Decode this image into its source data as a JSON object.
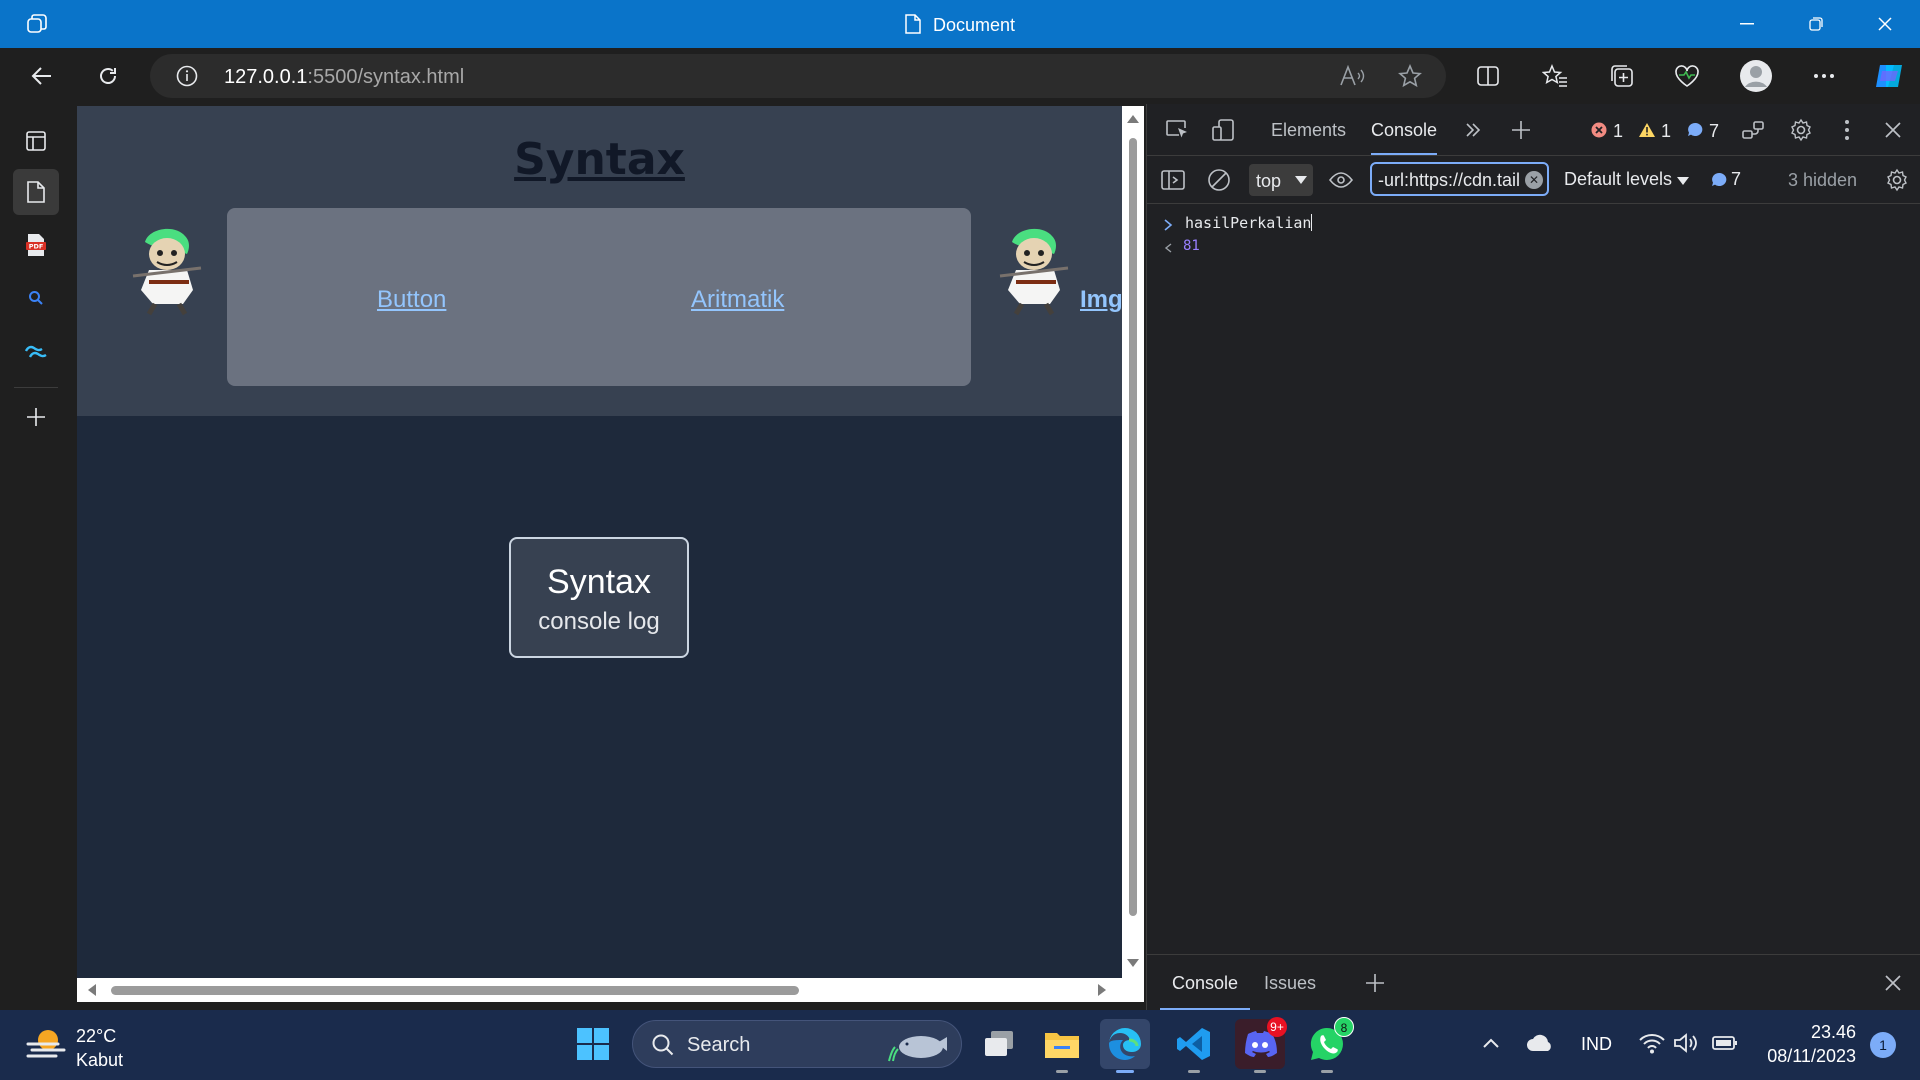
{
  "window": {
    "title": "Document"
  },
  "addressbar": {
    "url_host": "127.0.0.1",
    "url_rest": ":5500/syntax.html"
  },
  "page": {
    "title": "Syntax",
    "nav": [
      "Button",
      "Aritmatik"
    ],
    "img_link": "Img",
    "card": {
      "title": "Syntax",
      "subtitle": "console log"
    }
  },
  "devtools": {
    "tabs": [
      "Elements",
      "Console"
    ],
    "errors": "1",
    "warnings": "1",
    "messages": "7",
    "context": "top",
    "filter": "-url:https://cdn.tail",
    "levels": "Default levels",
    "level_count": "7",
    "hidden": "3 hidden",
    "input_line": "hasilPerkalian",
    "output_line": "81",
    "drawer_tabs": [
      "Console",
      "Issues"
    ]
  },
  "taskbar": {
    "temp": "22°C",
    "condition": "Kabut",
    "search": "Search",
    "lang": "IND",
    "time": "23.46",
    "date": "08/11/2023",
    "notifications": "1",
    "discord_badge": "9+",
    "whatsapp_badge": "8"
  },
  "colors": {
    "titlebar": "#0a74c9",
    "page_header": "#374151",
    "page_body": "#1e293b",
    "nav_box": "#6b7280",
    "link": "#93c5fd",
    "taskbar": "#1a2b4c"
  }
}
